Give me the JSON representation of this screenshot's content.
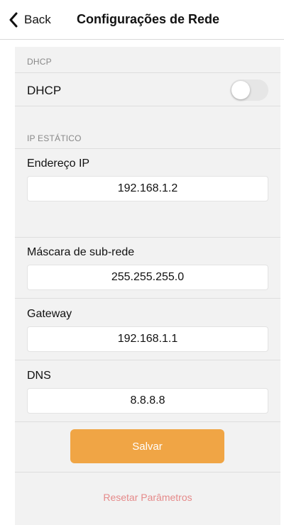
{
  "nav": {
    "back_label": "Back",
    "title": "Configurações de Rede"
  },
  "dhcp_section": {
    "header": "DHCP",
    "toggle_label": "DHCP",
    "toggle_on": false
  },
  "static_section": {
    "header": "IP ESTÁTICO",
    "fields": [
      {
        "label": "Endereço IP",
        "value": "192.168.1.2"
      },
      {
        "label": "Máscara de sub-rede",
        "value": "255.255.255.0"
      },
      {
        "label": "Gateway",
        "value": "192.168.1.1"
      },
      {
        "label": "DNS",
        "value": "8.8.8.8"
      }
    ]
  },
  "actions": {
    "save_label": "Salvar",
    "reset_label": "Resetar Parâmetros"
  },
  "colors": {
    "accent": "#f0a545",
    "reset_text": "#e58a8a",
    "panel_background": "#f2f2f2"
  },
  "icons": {
    "back": "chevron-left-icon"
  }
}
